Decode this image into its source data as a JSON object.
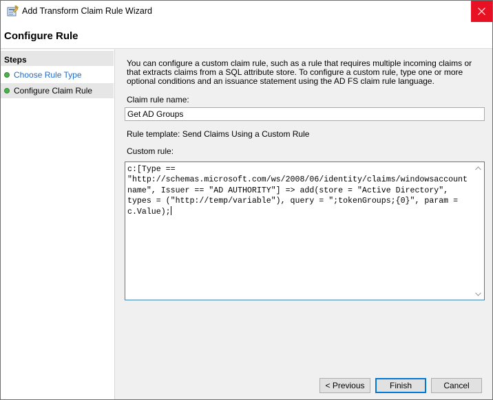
{
  "window": {
    "title": "Add Transform Claim Rule Wizard",
    "icon": "wizard-app-icon",
    "close_icon": "close-icon"
  },
  "header": {
    "title": "Configure Rule"
  },
  "steps": {
    "heading": "Steps",
    "items": [
      {
        "label": "Choose Rule Type",
        "state": "link"
      },
      {
        "label": "Configure Claim Rule",
        "state": "current"
      }
    ]
  },
  "content": {
    "description": "You can configure a custom claim rule, such as a rule that requires multiple incoming claims or that extracts claims from a SQL attribute store. To configure a custom rule, type one or more optional conditions and an issuance statement using the AD FS claim rule language.",
    "claim_rule_name_label": "Claim rule name:",
    "claim_rule_name_value": "Get AD Groups",
    "rule_template_label": "Rule template: Send Claims Using a Custom Rule",
    "custom_rule_label": "Custom rule:",
    "custom_rule_text": "c:[Type ==\n\"http://schemas.microsoft.com/ws/2008/06/identity/claims/windowsaccount\nname\", Issuer == \"AD AUTHORITY\"] => add(store = \"Active Directory\",\ntypes = (\"http://temp/variable\"), query = \";tokenGroups;{0}\", param =\nc.Value);"
  },
  "buttons": {
    "previous": "< Previous",
    "finish": "Finish",
    "cancel": "Cancel"
  },
  "colors": {
    "close_bg": "#e81123",
    "link": "#1e6bc9",
    "step_dot": "#4cb04c",
    "focus_border": "#3c7fb1"
  }
}
